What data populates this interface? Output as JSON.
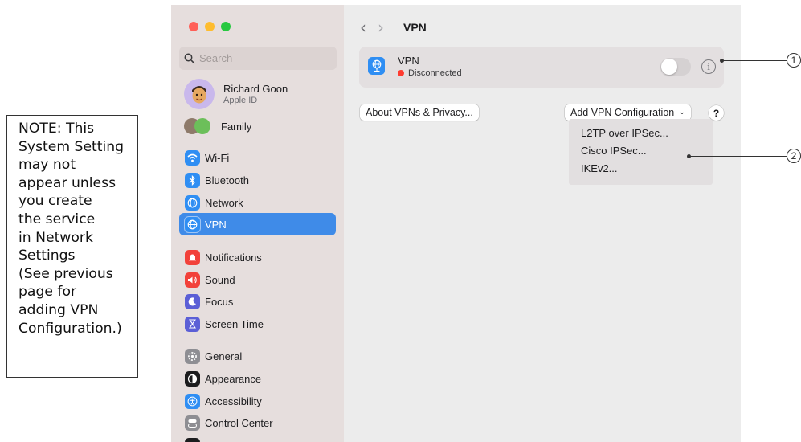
{
  "note": {
    "lines": [
      "NOTE: This",
      "System Setting",
      "may not",
      "appear unless",
      "you create",
      "the service",
      "in Network",
      "Settings",
      "(See previous",
      "page for",
      "adding VPN",
      "Configuration.)"
    ]
  },
  "sidebar": {
    "search_placeholder": "Search",
    "account": {
      "name": "Richard Goon",
      "subtitle": "Apple ID"
    },
    "family_label": "Family",
    "items": [
      {
        "label": "Wi-Fi",
        "icon": "wifi-icon",
        "color": "#2f8ef3"
      },
      {
        "label": "Bluetooth",
        "icon": "bluetooth-icon",
        "color": "#2f8ef3"
      },
      {
        "label": "Network",
        "icon": "network-globe-icon",
        "color": "#2f8ef3"
      },
      {
        "label": "VPN",
        "icon": "vpn-globe-icon",
        "color": "#2f8ef3",
        "selected": true
      },
      {
        "label": "Notifications",
        "icon": "notifications-bell-icon",
        "color": "#f2413a"
      },
      {
        "label": "Sound",
        "icon": "sound-speaker-icon",
        "color": "#f2413a"
      },
      {
        "label": "Focus",
        "icon": "focus-moon-icon",
        "color": "#5b5fd6"
      },
      {
        "label": "Screen Time",
        "icon": "screen-time-hourglass-icon",
        "color": "#5b5fd6"
      },
      {
        "label": "General",
        "icon": "general-gear-icon",
        "color": "#8e8e93"
      },
      {
        "label": "Appearance",
        "icon": "appearance-icon",
        "color": "#1c1c1e"
      },
      {
        "label": "Accessibility",
        "icon": "accessibility-icon",
        "color": "#2f8ef3"
      },
      {
        "label": "Control Center",
        "icon": "control-center-icon",
        "color": "#8e8e93"
      }
    ]
  },
  "main": {
    "title": "VPN",
    "vpn_service": {
      "name": "VPN",
      "status": "Disconnected",
      "enabled": false
    },
    "about_button": "About VPNs & Privacy...",
    "add_button": "Add VPN Configuration",
    "help_label": "?",
    "menu_items": [
      "L2TP over IPSec...",
      "Cisco IPSec...",
      "IKEv2..."
    ]
  },
  "callouts": {
    "one": "1",
    "two": "2"
  },
  "colors": {
    "accent": "#3f8be8",
    "sidebar_bg": "#e6dedd",
    "window_bg": "#ececec",
    "status_red": "#ff3b30"
  }
}
